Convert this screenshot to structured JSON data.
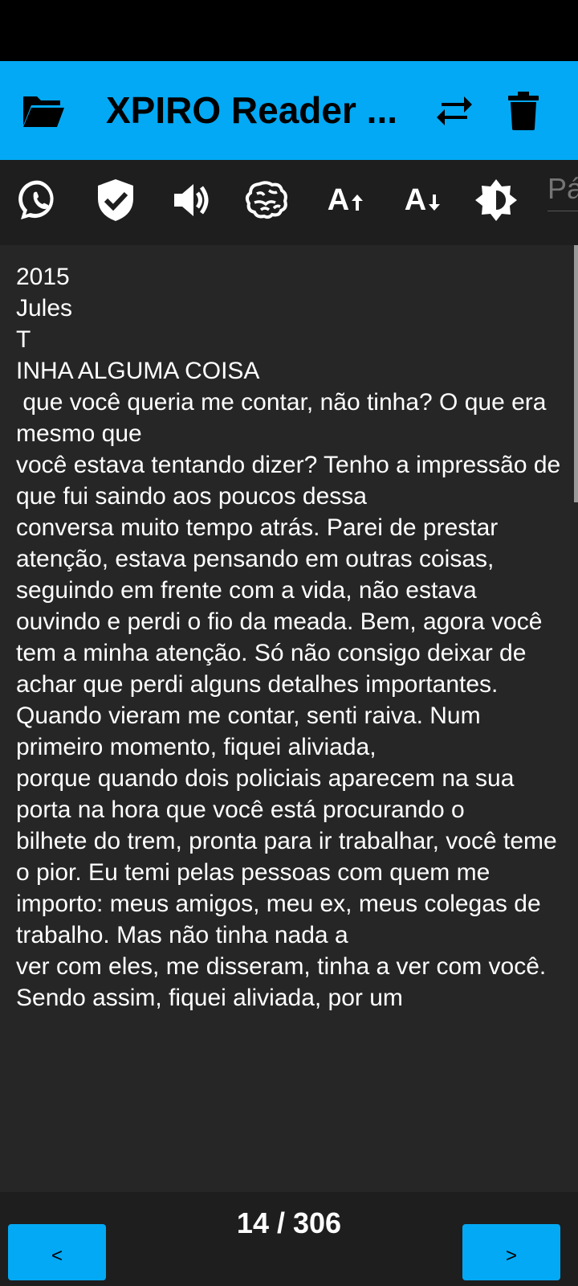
{
  "app_bar": {
    "title": "XPIRO Reader ...",
    "icons": [
      "folder-open-icon",
      "swap-icon",
      "trash-icon"
    ]
  },
  "toolbar": {
    "icons": [
      "whatsapp-icon",
      "shield-check-icon",
      "volume-icon",
      "brain-icon",
      "font-increase-icon",
      "font-decrease-icon",
      "brightness-icon"
    ],
    "font_increase_label": "A",
    "font_decrease_label": "A",
    "page_input_placeholder": "Página"
  },
  "content": {
    "text": "2015\nJules\nT\nINHA ALGUMA COISA\n que você queria me contar, não tinha? O que era mesmo que\nvocê estava tentando dizer? Tenho a impressão de que fui saindo aos poucos dessa\nconversa muito tempo atrás. Parei de prestar atenção, estava pensando em outras coisas,\nseguindo em frente com a vida, não estava ouvindo e perdi o fio da meada. Bem, agora você tem a minha atenção. Só não consigo deixar de achar que perdi alguns detalhes importantes.\nQuando vieram me contar, senti raiva. Num primeiro momento, fiquei aliviada,\nporque quando dois policiais aparecem na sua porta na hora que você está procurando o\nbilhete do trem, pronta para ir trabalhar, você teme o pior. Eu temi pelas pessoas com quem me importo: meus amigos, meu ex, meus colegas de trabalho. Mas não tinha nada a\nver com eles, me disseram, tinha a ver com você. Sendo assim, fiquei aliviada, por um"
  },
  "footer": {
    "prev_label": "<",
    "next_label": ">",
    "current_page": "14",
    "separator": " / ",
    "total_pages": "306"
  },
  "colors": {
    "accent": "#03a9f4",
    "toolbar_bg": "#1e1e1e",
    "content_bg": "#262626"
  }
}
